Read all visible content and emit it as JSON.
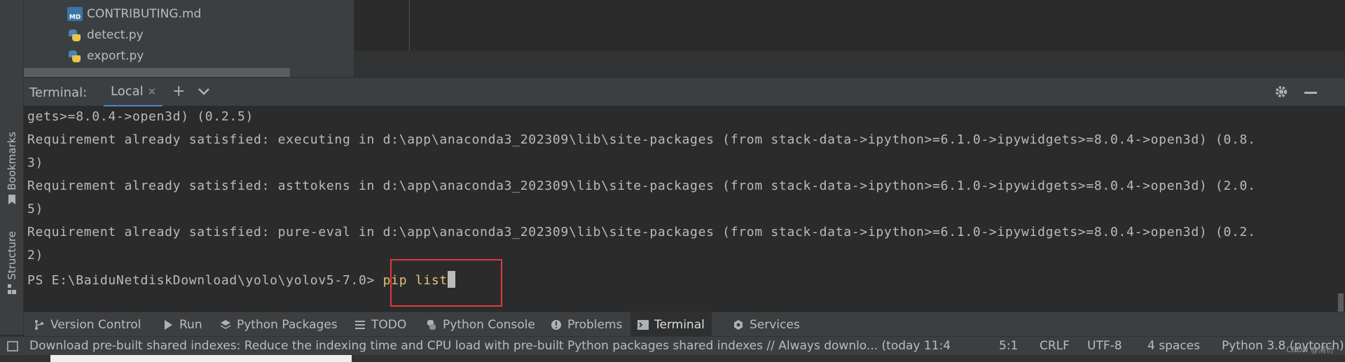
{
  "left_strip": {
    "bookmarks_label": "Bookmarks",
    "structure_label": "Structure"
  },
  "project_tree": {
    "files": [
      {
        "name": "CONTRIBUTING.md",
        "icon": "markdown-file-icon"
      },
      {
        "name": "detect.py",
        "icon": "python-file-icon"
      },
      {
        "name": "export.py",
        "icon": "python-file-icon"
      }
    ]
  },
  "terminal": {
    "title": "Terminal:",
    "tab_label": "Local",
    "lines": [
      "gets>=8.0.4->open3d) (0.2.5)",
      "Requirement already satisfied: executing in d:\\app\\anaconda3_202309\\lib\\site-packages (from stack-data->ipython>=6.1.0->ipywidgets>=8.0.4->open3d) (0.8.",
      "3)",
      "Requirement already satisfied: asttokens in d:\\app\\anaconda3_202309\\lib\\site-packages (from stack-data->ipython>=6.1.0->ipywidgets>=8.0.4->open3d) (2.0.",
      "5)",
      "Requirement already satisfied: pure-eval in d:\\app\\anaconda3_202309\\lib\\site-packages (from stack-data->ipython>=6.1.0->ipywidgets>=8.0.4->open3d) (0.2.",
      "2)"
    ],
    "prompt": "PS E:\\BaiduNetdiskDownload\\yolo\\yolov5-7.0> ",
    "command": "pip list",
    "highlight_color": "#e23a3a"
  },
  "tool_tabs": [
    {
      "label": "Version Control",
      "icon": "branch-icon",
      "active": false
    },
    {
      "label": "Run",
      "icon": "play-icon",
      "active": false
    },
    {
      "label": "Python Packages",
      "icon": "layers-icon",
      "active": false
    },
    {
      "label": "TODO",
      "icon": "list-icon",
      "active": false
    },
    {
      "label": "Python Console",
      "icon": "python-icon",
      "active": false
    },
    {
      "label": "Problems",
      "icon": "info-icon",
      "active": false
    },
    {
      "label": "Terminal",
      "icon": "terminal-icon",
      "active": true
    },
    {
      "label": "Services",
      "icon": "services-icon",
      "active": false
    }
  ],
  "status_bar": {
    "message": "Download pre-built shared indexes: Reduce the indexing time and CPU load with pre-built Python packages shared indexes // Always downlo... (today 11:4",
    "position": "5:1",
    "line_sep": "CRLF",
    "encoding": "UTF-8",
    "indent": "4 spaces",
    "interpreter": "Python 3.8 (pytorch)",
    "watermark": "CSDN @清衍"
  }
}
